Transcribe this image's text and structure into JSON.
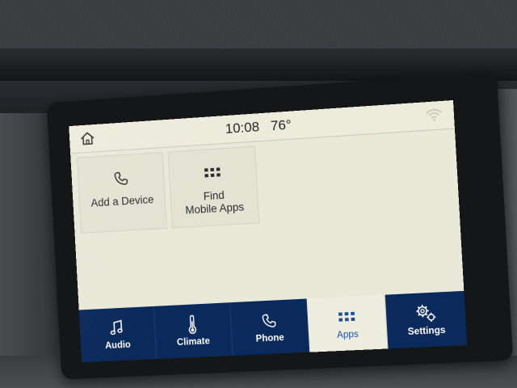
{
  "status_bar": {
    "time": "10:08",
    "temperature": "76°"
  },
  "tiles": [
    {
      "label": "Add a Device",
      "icon": "phone-icon"
    },
    {
      "label_line1": "Find",
      "label_line2": "Mobile Apps",
      "icon": "grid-icon"
    }
  ],
  "dock": {
    "items": [
      {
        "label": "Audio",
        "icon": "music-note-icon"
      },
      {
        "label": "Climate",
        "icon": "thermometer-icon"
      },
      {
        "label": "Phone",
        "icon": "phone-icon"
      },
      {
        "label": "Apps",
        "icon": "grid-icon",
        "active": true
      },
      {
        "label": "Settings",
        "icon": "gears-icon"
      }
    ]
  },
  "colors": {
    "screen_bg": "#e9e9d9",
    "dock_bg": "#0b2a5c",
    "active_text": "#1f4d9a"
  }
}
